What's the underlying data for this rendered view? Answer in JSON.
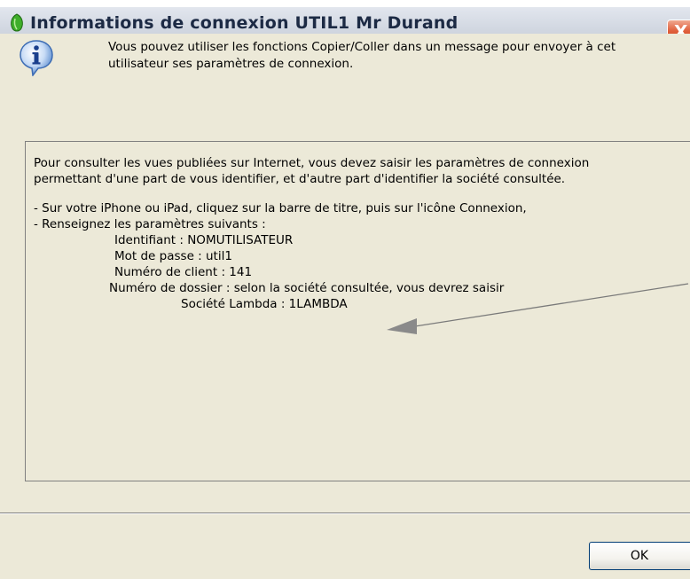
{
  "window": {
    "title": "Informations de connexion UTIL1 Mr Durand",
    "close_glyph": "X",
    "app_icon": "green-leaf-icon",
    "accent_color": "#e0603c"
  },
  "info": {
    "icon": "info-icon",
    "message_line1": "Vous pouvez utiliser les fonctions Copier/Coller dans un message pour envoyer à cet",
    "message_line2": "utilisateur ses paramètres de connexion."
  },
  "content": {
    "intro_line1": "Pour consulter les vues publiées sur Internet, vous devez saisir les paramètres de connexion",
    "intro_line2": "permettant d'une part de vous identifier, et d'autre part d'identifier la société consultée.",
    "step1": "- Sur votre iPhone ou iPad, cliquez sur la barre de titre, puis sur l'icône Connexion,",
    "step2": "- Renseignez les paramètres suivants :",
    "identifiant": "Identifiant : NOMUTILISATEUR",
    "mot_de_passe": "Mot de passe : util1",
    "numero_client": "Numéro de client : 141",
    "numero_dossier": "Numéro de dossier : selon la société consultée, vous devrez saisir",
    "societe": "Société Lambda : 1LAMBDA"
  },
  "buttons": {
    "ok_label": "OK"
  }
}
